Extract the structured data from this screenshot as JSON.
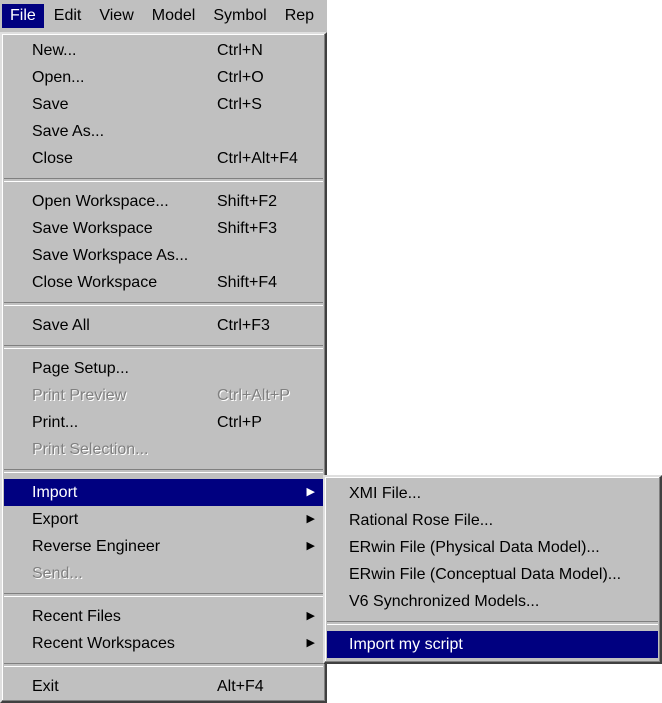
{
  "menubar": [
    "File",
    "Edit",
    "View",
    "Model",
    "Symbol",
    "Rep"
  ],
  "file_menu": {
    "new": {
      "label": "New...",
      "shortcut": "Ctrl+N"
    },
    "open": {
      "label": "Open...",
      "shortcut": "Ctrl+O"
    },
    "save": {
      "label": "Save",
      "shortcut": "Ctrl+S"
    },
    "save_as": {
      "label": "Save As..."
    },
    "close": {
      "label": "Close",
      "shortcut": "Ctrl+Alt+F4"
    },
    "open_workspace": {
      "label": "Open Workspace...",
      "shortcut": "Shift+F2"
    },
    "save_workspace": {
      "label": "Save Workspace",
      "shortcut": "Shift+F3"
    },
    "save_workspace_as": {
      "label": "Save Workspace As..."
    },
    "close_workspace": {
      "label": "Close Workspace",
      "shortcut": "Shift+F4"
    },
    "save_all": {
      "label": "Save All",
      "shortcut": "Ctrl+F3"
    },
    "page_setup": {
      "label": "Page Setup..."
    },
    "print_preview": {
      "label": "Print Preview",
      "shortcut": "Ctrl+Alt+P"
    },
    "print": {
      "label": "Print...",
      "shortcut": "Ctrl+P"
    },
    "print_selection": {
      "label": "Print Selection..."
    },
    "import": {
      "label": "Import"
    },
    "export": {
      "label": "Export"
    },
    "reverse_engineer": {
      "label": "Reverse Engineer"
    },
    "send": {
      "label": "Send..."
    },
    "recent_files": {
      "label": "Recent Files"
    },
    "recent_workspaces": {
      "label": "Recent Workspaces"
    },
    "exit": {
      "label": "Exit",
      "shortcut": "Alt+F4"
    }
  },
  "import_submenu": {
    "xmi": "XMI File...",
    "rational_rose": "Rational Rose File...",
    "erwin_physical": "ERwin File (Physical Data Model)...",
    "erwin_conceptual": "ERwin File (Conceptual Data Model)...",
    "v6_sync": "V6 Synchronized Models...",
    "my_script": "Import my script"
  },
  "icons": {
    "submenu_arrow": "triangle-right-icon"
  }
}
